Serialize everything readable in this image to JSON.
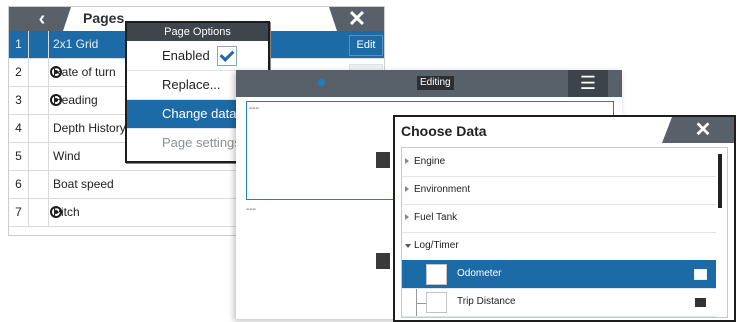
{
  "pages": {
    "title": "Pages",
    "back_icon": "chevron-left-icon",
    "close_icon": "close-icon",
    "rows": [
      {
        "num": "1",
        "label": "2x1 Grid",
        "has_icon": false,
        "selected": true
      },
      {
        "num": "2",
        "label": "Rate of turn",
        "has_icon": true,
        "selected": false
      },
      {
        "num": "3",
        "label": "Heading",
        "has_icon": true,
        "selected": false
      },
      {
        "num": "4",
        "label": "Depth History",
        "has_icon": false,
        "selected": false
      },
      {
        "num": "5",
        "label": "Wind",
        "has_icon": false,
        "selected": false
      },
      {
        "num": "6",
        "label": "Boat speed",
        "has_icon": false,
        "selected": false
      },
      {
        "num": "7",
        "label": "Pitch",
        "has_icon": true,
        "selected": false
      }
    ],
    "edit_label": "Edit"
  },
  "page_options": {
    "title": "Page Options",
    "items": [
      {
        "label": "Enabled",
        "checked": true
      },
      {
        "label": "Replace..."
      },
      {
        "label": "Change data...",
        "selected": true
      },
      {
        "label": "Page settings...",
        "disabled": true
      }
    ]
  },
  "editing": {
    "title": "Editing",
    "menu_icon": "hamburger-menu-icon",
    "field_placeholder_1": "---",
    "field_placeholder_2": "---"
  },
  "choose_data": {
    "title": "Choose Data",
    "close_icon": "close-icon",
    "items": [
      {
        "label": "Engine",
        "expanded": false
      },
      {
        "label": "Environment",
        "expanded": false
      },
      {
        "label": "Fuel Tank",
        "expanded": false
      },
      {
        "label": "Log/Timer",
        "expanded": true
      },
      {
        "label": "Odometer",
        "child": true,
        "selected": true
      },
      {
        "label": "Trip Distance",
        "child": true
      }
    ]
  },
  "colors": {
    "accent": "#1c6aa6",
    "header": "#58606a"
  }
}
